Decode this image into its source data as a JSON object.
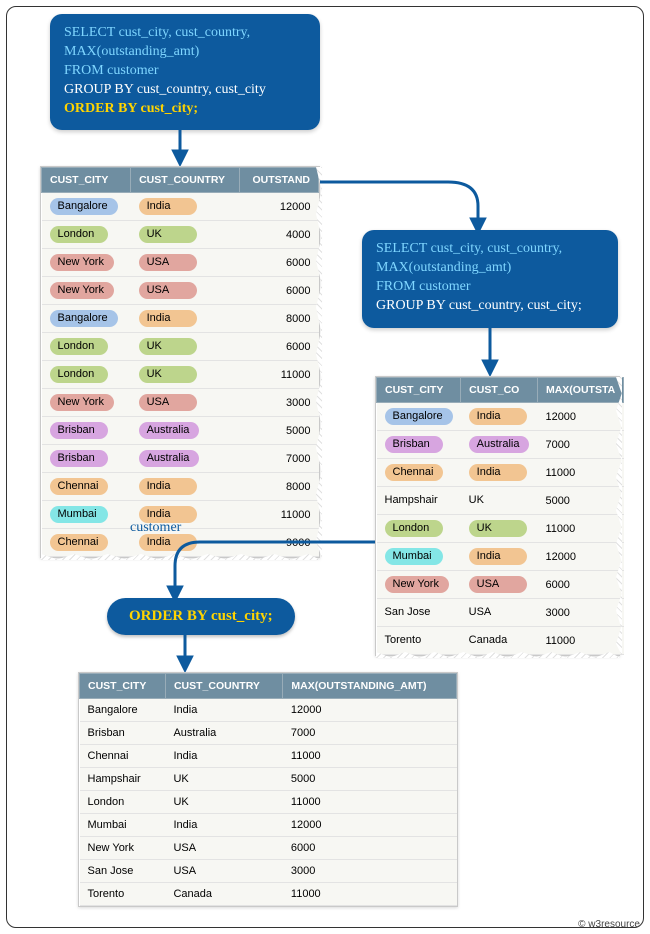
{
  "sql1": {
    "line1": "SELECT cust_city, cust_country,",
    "line2": "MAX(outstanding_amt)",
    "line3": "FROM customer",
    "line4": "GROUP BY cust_country, cust_city",
    "line5": "ORDER BY cust_city;"
  },
  "sql2": {
    "line1": "SELECT cust_city, cust_country,",
    "line2": "MAX(outstanding_amt)",
    "line3": "FROM customer",
    "line4": "GROUP BY cust_country, cust_city;"
  },
  "sql3": {
    "text": "ORDER BY cust_city;"
  },
  "customer_caption": "customer",
  "credit": "© w3resource",
  "tableA": {
    "headers": [
      "CUST_CITY",
      "CUST_COUNTRY",
      "OUTSTAND"
    ],
    "rows": [
      {
        "city": "Bangalore",
        "country": "India",
        "amt": "12000",
        "cc": "c-blue",
        "kc": "c-orange"
      },
      {
        "city": "London",
        "country": "UK",
        "amt": "4000",
        "cc": "c-green",
        "kc": "c-green"
      },
      {
        "city": "New York",
        "country": "USA",
        "amt": "6000",
        "cc": "c-red",
        "kc": "c-red"
      },
      {
        "city": "New York",
        "country": "USA",
        "amt": "6000",
        "cc": "c-red",
        "kc": "c-red"
      },
      {
        "city": "Bangalore",
        "country": "India",
        "amt": "8000",
        "cc": "c-blue",
        "kc": "c-orange"
      },
      {
        "city": "London",
        "country": "UK",
        "amt": "6000",
        "cc": "c-green",
        "kc": "c-green"
      },
      {
        "city": "London",
        "country": "UK",
        "amt": "11000",
        "cc": "c-green",
        "kc": "c-green"
      },
      {
        "city": "New York",
        "country": "USA",
        "amt": "3000",
        "cc": "c-red",
        "kc": "c-red"
      },
      {
        "city": "Brisban",
        "country": "Australia",
        "amt": "5000",
        "cc": "c-purple",
        "kc": "c-purple"
      },
      {
        "city": "Brisban",
        "country": "Australia",
        "amt": "7000",
        "cc": "c-purple",
        "kc": "c-purple"
      },
      {
        "city": "Chennai",
        "country": "India",
        "amt": "8000",
        "cc": "c-orange",
        "kc": "c-orange"
      },
      {
        "city": "Mumbai",
        "country": "India",
        "amt": "11000",
        "cc": "c-cyan",
        "kc": "c-orange"
      },
      {
        "city": "Chennai",
        "country": "India",
        "amt": "9000",
        "cc": "c-orange",
        "kc": "c-orange"
      }
    ]
  },
  "tableB": {
    "headers": [
      "CUST_CITY",
      "CUST_CO",
      "MAX(OUTSTA"
    ],
    "rows": [
      {
        "city": "Bangalore",
        "country": "India",
        "amt": "12000",
        "cc": "c-blue",
        "kc": "c-orange"
      },
      {
        "city": "Brisban",
        "country": "Australia",
        "amt": "7000",
        "cc": "c-purple",
        "kc": "c-purple"
      },
      {
        "city": "Chennai",
        "country": "India",
        "amt": "11000",
        "cc": "c-orange",
        "kc": "c-orange"
      },
      {
        "city": "Hampshair",
        "country": "UK",
        "amt": "5000",
        "cc": "c-none",
        "kc": "c-none"
      },
      {
        "city": "London",
        "country": "UK",
        "amt": "11000",
        "cc": "c-green",
        "kc": "c-green"
      },
      {
        "city": "Mumbai",
        "country": "India",
        "amt": "12000",
        "cc": "c-cyan",
        "kc": "c-orange"
      },
      {
        "city": "New York",
        "country": "USA",
        "amt": "6000",
        "cc": "c-red",
        "kc": "c-red"
      },
      {
        "city": "San Jose",
        "country": "USA",
        "amt": "3000",
        "cc": "c-none",
        "kc": "c-none"
      },
      {
        "city": "Torento",
        "country": "Canada",
        "amt": "11000",
        "cc": "c-none",
        "kc": "c-none"
      }
    ]
  },
  "tableC": {
    "headers": [
      "CUST_CITY",
      "CUST_COUNTRY",
      "MAX(OUTSTANDING_AMT)"
    ],
    "rows": [
      {
        "city": "Bangalore",
        "country": "India",
        "amt": "12000"
      },
      {
        "city": "Brisban",
        "country": "Australia",
        "amt": "7000"
      },
      {
        "city": "Chennai",
        "country": "India",
        "amt": "11000"
      },
      {
        "city": "Hampshair",
        "country": "UK",
        "amt": "5000"
      },
      {
        "city": "London",
        "country": "UK",
        "amt": "11000"
      },
      {
        "city": "Mumbai",
        "country": "India",
        "amt": "12000"
      },
      {
        "city": "New York",
        "country": "USA",
        "amt": "6000"
      },
      {
        "city": "San Jose",
        "country": "USA",
        "amt": "3000"
      },
      {
        "city": "Torento",
        "country": "Canada",
        "amt": "11000"
      }
    ]
  },
  "chart_data": {
    "type": "table",
    "source_table": "customer",
    "query": "SELECT cust_city, cust_country, MAX(outstanding_amt) FROM customer GROUP BY cust_country, cust_city ORDER BY cust_city;",
    "raw_rows": [
      [
        "Bangalore",
        "India",
        12000
      ],
      [
        "London",
        "UK",
        4000
      ],
      [
        "New York",
        "USA",
        6000
      ],
      [
        "New York",
        "USA",
        6000
      ],
      [
        "Bangalore",
        "India",
        8000
      ],
      [
        "London",
        "UK",
        6000
      ],
      [
        "London",
        "UK",
        11000
      ],
      [
        "New York",
        "USA",
        3000
      ],
      [
        "Brisban",
        "Australia",
        5000
      ],
      [
        "Brisban",
        "Australia",
        7000
      ],
      [
        "Chennai",
        "India",
        8000
      ],
      [
        "Mumbai",
        "India",
        11000
      ],
      [
        "Chennai",
        "India",
        9000
      ]
    ],
    "grouped_rows": [
      [
        "Bangalore",
        "India",
        12000
      ],
      [
        "Brisban",
        "Australia",
        7000
      ],
      [
        "Chennai",
        "India",
        11000
      ],
      [
        "Hampshair",
        "UK",
        5000
      ],
      [
        "London",
        "UK",
        11000
      ],
      [
        "Mumbai",
        "India",
        12000
      ],
      [
        "New York",
        "USA",
        6000
      ],
      [
        "San Jose",
        "USA",
        3000
      ],
      [
        "Torento",
        "Canada",
        11000
      ]
    ]
  }
}
